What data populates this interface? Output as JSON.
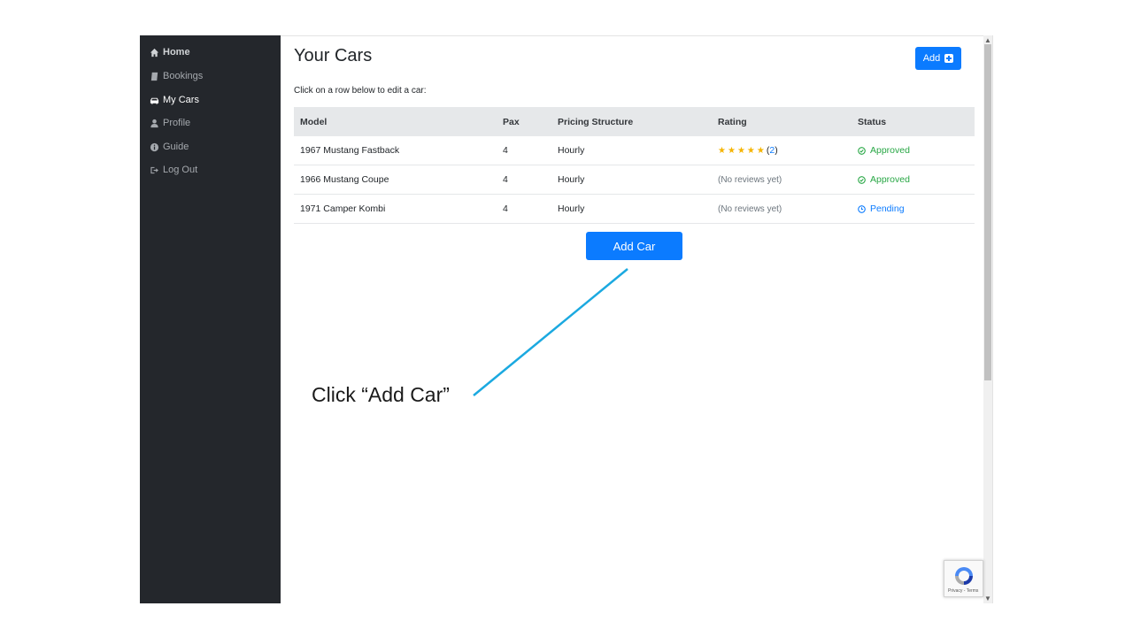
{
  "sidebar": {
    "items": [
      {
        "label": "Home",
        "icon": "home-icon"
      },
      {
        "label": "Bookings",
        "icon": "book-icon"
      },
      {
        "label": "My Cars",
        "icon": "car-icon"
      },
      {
        "label": "Profile",
        "icon": "user-icon"
      },
      {
        "label": "Guide",
        "icon": "info-icon"
      },
      {
        "label": "Log Out",
        "icon": "logout-icon"
      }
    ],
    "active": "My Cars"
  },
  "main": {
    "title": "Your Cars",
    "add_button_label": "Add",
    "instruction": "Click on a row below to edit a car:",
    "add_car_button_label": "Add Car"
  },
  "table": {
    "columns": [
      "Model",
      "Pax",
      "Pricing Structure",
      "Rating",
      "Status"
    ],
    "rows": [
      {
        "model": "1967 Mustang Fastback",
        "pax": "4",
        "pricing": "Hourly",
        "rating_stars": 5,
        "rating_count": "2",
        "rating_text": "",
        "status": "Approved"
      },
      {
        "model": "1966 Mustang Coupe",
        "pax": "4",
        "pricing": "Hourly",
        "rating_stars": 0,
        "rating_count": "",
        "rating_text": "(No reviews yet)",
        "status": "Approved"
      },
      {
        "model": "1971 Camper Kombi",
        "pax": "4",
        "pricing": "Hourly",
        "rating_stars": 0,
        "rating_count": "",
        "rating_text": "(No reviews yet)",
        "status": "Pending"
      }
    ]
  },
  "recaptcha": {
    "footer": "Privacy - Terms"
  },
  "annotation": {
    "text": "Click “Add Car”"
  },
  "colors": {
    "sidebar_bg": "#24272c",
    "primary": "#0b7bff",
    "approved": "#28a745",
    "star": "#f5b400",
    "annotation_line": "#1ba9e0"
  }
}
